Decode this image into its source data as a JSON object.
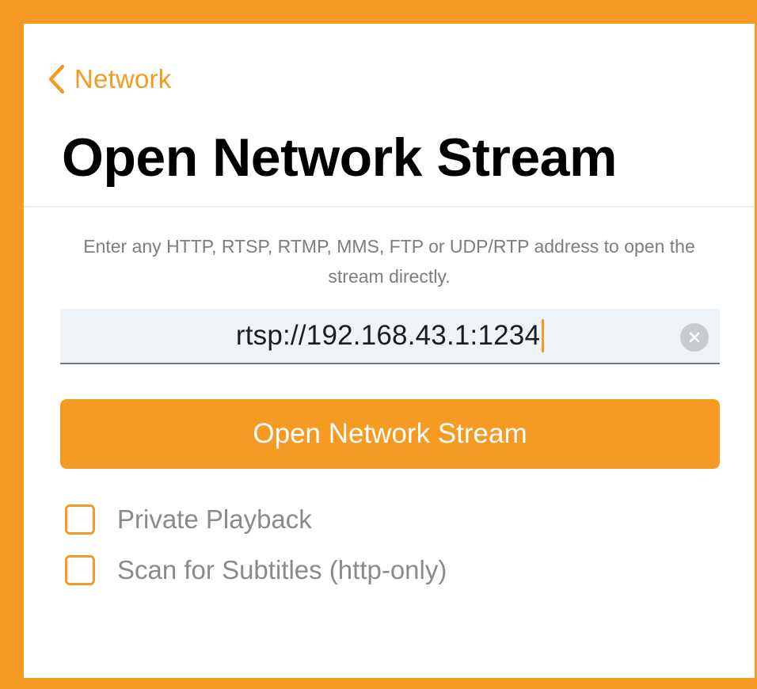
{
  "colors": {
    "accent": "#f59a23",
    "title": "#000000",
    "muted_text": "#7d7d7d",
    "field_background": "#eef3f7"
  },
  "nav": {
    "back_label": "Network",
    "back_icon": "chevron-left-icon"
  },
  "page": {
    "title": "Open Network Stream",
    "help_text": "Enter any HTTP, RTSP, RTMP, MMS, FTP or UDP/RTP address to open the stream directly."
  },
  "url_field": {
    "value": "rtsp://192.168.43.1:1234",
    "clear_icon": "clear-circle-icon"
  },
  "actions": {
    "open_label": "Open Network Stream"
  },
  "options": [
    {
      "label": "Private Playback",
      "checked": false
    },
    {
      "label": "Scan for Subtitles (http-only)",
      "checked": false
    }
  ]
}
